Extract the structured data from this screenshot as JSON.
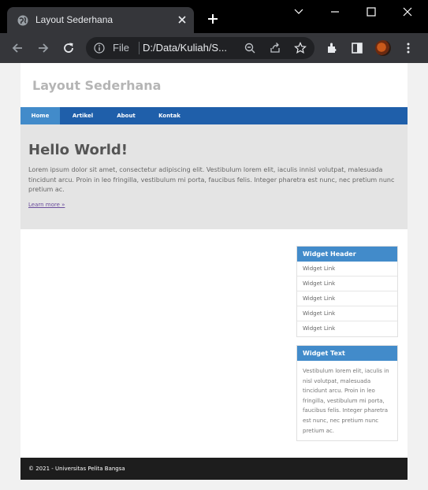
{
  "browser": {
    "tab_title": "Layout Sederhana",
    "omnibox_scheme": "File",
    "omnibox_url": "D:/Data/Kuliah/S..."
  },
  "site": {
    "header_title": "Layout Sederhana",
    "nav": [
      "Home",
      "Artikel",
      "About",
      "Kontak"
    ],
    "hero": {
      "title": "Hello World!",
      "text": "Lorem ipsum dolor sit amet, consectetur adipiscing elit. Vestibulum lorem elit, iaculis innisl volutpat, malesuada tincidunt arcu. Proin in leo fringilla, vestibulum mi porta, faucibus felis. Integer pharetra est nunc, nec pretium nunc pretium ac.",
      "link": "Learn more »"
    },
    "widget_links": {
      "header": "Widget Header",
      "links": [
        "Widget Link",
        "Widget Link",
        "Widget Link",
        "Widget Link",
        "Widget Link"
      ]
    },
    "widget_text": {
      "header": "Widget Text",
      "body": "Vestibulum lorem elit, iaculis in nisl volutpat, malesuada tincidunt arcu. Proin in leo fringilla, vestibulum mi porta, faucibus felis. Integer pharetra est nunc, nec pretium nunc pretium ac."
    },
    "footer": "© 2021 - Universitas Pelita Bangsa"
  },
  "colors": {
    "nav_bg": "#1f5faa",
    "nav_active": "#428bca",
    "widget_header": "#428bca",
    "hero_bg": "#e4e4e4",
    "footer_bg": "#1d1d1d"
  }
}
